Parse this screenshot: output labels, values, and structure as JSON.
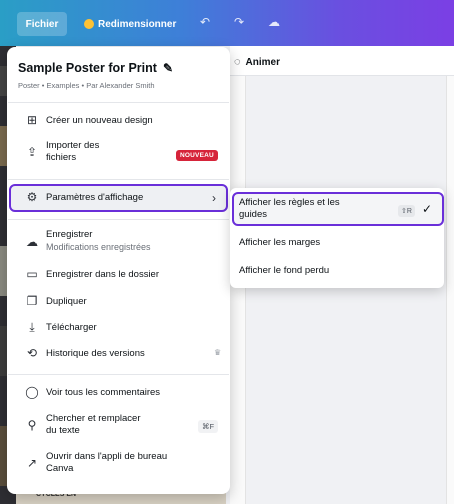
{
  "toolbar": {
    "file_label": "Fichier",
    "resize_label": "Redimensionner",
    "undo_icon": "undo-icon",
    "redo_icon": "redo-icon",
    "cloud_icon": "cloud-check-icon"
  },
  "header": {
    "animate_label": "Animer"
  },
  "menu": {
    "title": "Sample Poster for Print",
    "subtitle": "Poster • Examples • Par Alexander Smith",
    "items": [
      {
        "label": "Créer un nouveau design",
        "icon": "plus-icon"
      },
      {
        "label": "Importer des",
        "label2": "fichiers",
        "icon": "cloud-upload-icon",
        "badge": "NOUVEAU"
      },
      {
        "label": "Paramètres d'affichage",
        "icon": "gear-icon"
      },
      {
        "label": "Enregistrer",
        "sub": "Modifications enregistrées",
        "icon": "cloud-check-icon"
      },
      {
        "label": "Enregistrer dans le dossier",
        "icon": "folder-icon"
      },
      {
        "label": "Dupliquer",
        "icon": "duplicate-icon"
      },
      {
        "label": "Télécharger",
        "icon": "download-icon"
      },
      {
        "label": "Historique des versions",
        "icon": "history-icon"
      },
      {
        "label": "Voir tous les commentaires",
        "icon": "comment-icon"
      },
      {
        "label": "Chercher et remplacer",
        "label2": "du texte",
        "icon": "search-icon",
        "shortcut": "⌘F"
      },
      {
        "label": "Ouvrir dans l'appli de bureau",
        "label2": "Canva",
        "icon": "external-link-icon"
      }
    ]
  },
  "submenu": {
    "items": [
      {
        "label": "Afficher les règles et les",
        "label2": "guides",
        "shortcut": "⇧R",
        "checked": true
      },
      {
        "label": "Afficher les marges"
      },
      {
        "label": "Afficher le fond perdu"
      }
    ]
  },
  "background": {
    "bottom_text": "CYCLES EN"
  },
  "colors": {
    "accent": "#6a2fd9",
    "badge": "#d6243a"
  }
}
